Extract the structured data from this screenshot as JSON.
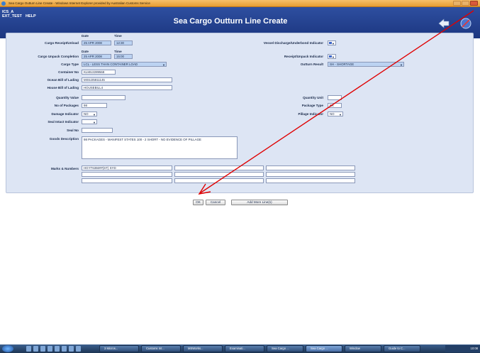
{
  "window": {
    "title": "Sea Cargo Outturn Line Create - Windows Internet Explorer provided by Australian Customs Service"
  },
  "header": {
    "system_line1": "ICS_A",
    "system_line2": "EXT_TEST",
    "help": "HELP",
    "page_title": "Sea Cargo Outturn Line Create"
  },
  "form": {
    "date_label": "Date",
    "time_label": "Time",
    "cargo_receipt_unload": {
      "label": "Cargo Receipt/Unload",
      "date": "25 APR 2008",
      "time": "12:30"
    },
    "cargo_unpack_completion": {
      "label": "Cargo Unpack Completion",
      "date": "25 APR 2008",
      "time": "15:00"
    },
    "cargo_type": {
      "label": "Cargo Type",
      "value": "LCL - LESS THAN CONTAINER LOAD"
    },
    "container_no": {
      "label": "Container No",
      "value": "KLMU2289568"
    },
    "ocean_bill_of_lading": {
      "label": "Ocean Bill of Lading",
      "value": "MISU25811145"
    },
    "house_bill_of_lading": {
      "label": "House Bill of Lading",
      "value": "HOUSEBILL4"
    },
    "quantity_value": {
      "label": "Quantity Value",
      "value": ""
    },
    "no_of_packages": {
      "label": "No of Packages",
      "value": "98"
    },
    "damage_indicator": {
      "label": "Damage Indicator",
      "value": "NO"
    },
    "seal_intact_indicator": {
      "label": "Seal Intact Indicator",
      "value": ""
    },
    "seal_no": {
      "label": "Seal No",
      "value": ""
    },
    "goods_description": {
      "label": "Goods Description",
      "value": "98 PACKAGES - MANIFEST STATES 100 - 2 SHORT - NO EVIDENCE OF PILLAGE"
    },
    "marks_numbers": {
      "label": "Marks & Numbers",
      "value": "HGYT6366##(ST) SYD"
    },
    "vessel_discharge": {
      "label": "Vessel Discharge/Underbond Indicator"
    },
    "receipt_unpack": {
      "label": "Receipt/Unpack Indicator"
    },
    "outturn_result": {
      "label": "Outturn Result",
      "value": "SH - SHORTAGE"
    },
    "quantity_unit": {
      "label": "Quantity Unit",
      "value": ""
    },
    "package_type": {
      "label": "Package Type",
      "value": "BX"
    },
    "pillage_indicator": {
      "label": "Pillage Indicator",
      "value": "NO"
    }
  },
  "buttons": {
    "ok": "OK",
    "cancel": "Cancel",
    "add_more": "Add More Line(s)"
  },
  "taskbar": {
    "items": [
      "3 Micros...",
      "Customs Int...",
      "MSWorks...",
      "Examinati...",
      "Sea Cargo ...",
      "Sea Cargo ...",
      "Window",
      "Guide to C..."
    ],
    "clock": "10:08"
  },
  "colors": {
    "header": "#1c3680",
    "panel": "#dde5f4",
    "annotation_line": "#e00000"
  }
}
